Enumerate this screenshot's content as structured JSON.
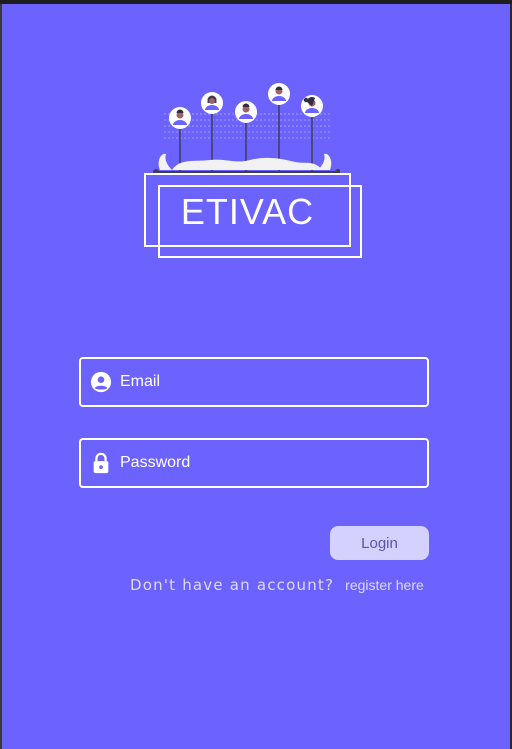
{
  "app": {
    "logo_text": "ETIVAC"
  },
  "form": {
    "email_placeholder": "Email",
    "password_placeholder": "Password",
    "login_label": "Login"
  },
  "footer": {
    "no_account_text": "Don't have an account?",
    "register_label": "register here"
  },
  "icons": {
    "email": "account-circle-icon",
    "password": "lock-icon",
    "illustration": "team-people-illustration"
  },
  "colors": {
    "background": "#6c63ff",
    "text": "#ffffff",
    "button_bg": "#d4d1ff",
    "button_text": "#5a55a8",
    "muted_text": "#dcd9ff"
  }
}
